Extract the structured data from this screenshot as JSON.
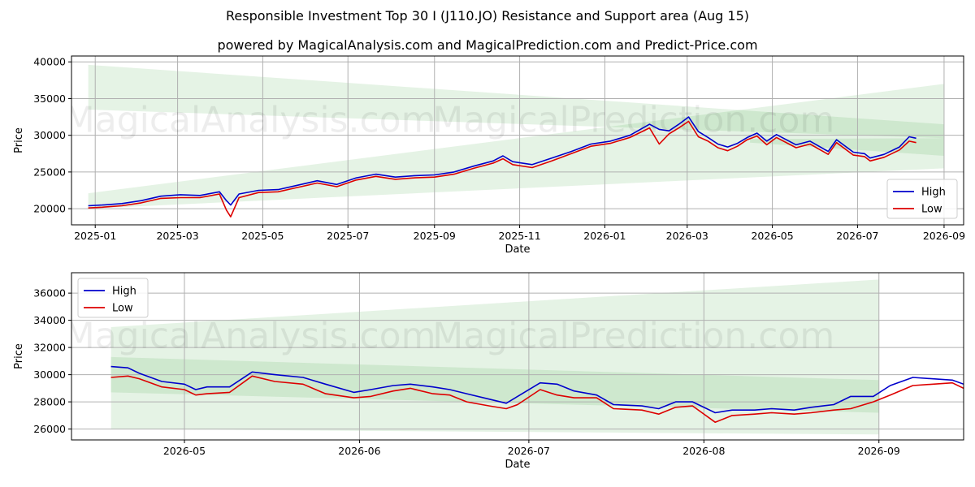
{
  "header": {
    "title": "Responsible Investment Top 30 I (J110.JO) Resistance and Support area (Aug 15)",
    "subtitle": "powered by MagicalAnalysis.com and MagicalPrediction.com and Predict-Price.com"
  },
  "watermark": {
    "text_left": "MagicalAnalysis.com",
    "text_right": "MagicalPrediction.com"
  },
  "colors": {
    "high": "#0000cc",
    "low": "#dd0000",
    "band": "#2ca02c",
    "grid": "#b0b0b0"
  },
  "chart_data": [
    {
      "type": "line",
      "xlabel": "Date",
      "ylabel": "Price",
      "x_ticks": [
        "2025-01",
        "2025-03",
        "2025-05",
        "2025-07",
        "2025-09",
        "2025-11",
        "2026-01",
        "2026-03",
        "2026-05",
        "2026-07",
        "2026-09"
      ],
      "x_range": [
        "2024-12-15",
        "2026-09-15"
      ],
      "y_ticks": [
        20000,
        25000,
        30000,
        35000,
        40000
      ],
      "ylim": [
        17800,
        40800
      ],
      "grid": true,
      "legend": "lower-right",
      "series": [
        {
          "name": "High",
          "color": "#0000cc",
          "points": [
            [
              "2024-12-27",
              20400
            ],
            [
              "2025-01-06",
              20500
            ],
            [
              "2025-01-20",
              20700
            ],
            [
              "2025-02-03",
              21100
            ],
            [
              "2025-02-17",
              21700
            ],
            [
              "2025-03-03",
              21900
            ],
            [
              "2025-03-17",
              21800
            ],
            [
              "2025-03-31",
              22300
            ],
            [
              "2025-04-05",
              21100
            ],
            [
              "2025-04-08",
              20500
            ],
            [
              "2025-04-14",
              22000
            ],
            [
              "2025-04-28",
              22500
            ],
            [
              "2025-05-12",
              22600
            ],
            [
              "2025-05-26",
              23200
            ],
            [
              "2025-06-09",
              23800
            ],
            [
              "2025-06-23",
              23300
            ],
            [
              "2025-07-07",
              24200
            ],
            [
              "2025-07-21",
              24700
            ],
            [
              "2025-08-04",
              24300
            ],
            [
              "2025-08-18",
              24500
            ],
            [
              "2025-09-01",
              24600
            ],
            [
              "2025-09-15",
              25000
            ],
            [
              "2025-09-29",
              25800
            ],
            [
              "2025-10-13",
              26500
            ],
            [
              "2025-10-20",
              27200
            ],
            [
              "2025-10-27",
              26400
            ],
            [
              "2025-11-10",
              26000
            ],
            [
              "2025-11-24",
              26900
            ],
            [
              "2025-12-08",
              27800
            ],
            [
              "2025-12-22",
              28800
            ],
            [
              "2026-01-05",
              29200
            ],
            [
              "2026-01-19",
              30000
            ],
            [
              "2026-02-02",
              31500
            ],
            [
              "2026-02-09",
              30800
            ],
            [
              "2026-02-16",
              30600
            ],
            [
              "2026-02-23",
              31500
            ],
            [
              "2026-03-02",
              32500
            ],
            [
              "2026-03-09",
              30500
            ],
            [
              "2026-03-16",
              29700
            ],
            [
              "2026-03-23",
              28800
            ],
            [
              "2026-03-30",
              28400
            ],
            [
              "2026-04-06",
              28900
            ],
            [
              "2026-04-13",
              29700
            ],
            [
              "2026-04-20",
              30300
            ],
            [
              "2026-04-27",
              29200
            ],
            [
              "2026-05-04",
              30100
            ],
            [
              "2026-05-18",
              28700
            ],
            [
              "2026-05-28",
              29200
            ],
            [
              "2026-06-10",
              27800
            ],
            [
              "2026-06-16",
              29400
            ],
            [
              "2026-06-28",
              27700
            ],
            [
              "2026-07-06",
              27500
            ],
            [
              "2026-07-10",
              26900
            ],
            [
              "2026-07-20",
              27400
            ],
            [
              "2026-07-31",
              28400
            ],
            [
              "2026-08-07",
              29800
            ],
            [
              "2026-08-12",
              29600
            ]
          ]
        },
        {
          "name": "Low",
          "color": "#dd0000",
          "points": [
            [
              "2024-12-27",
              20100
            ],
            [
              "2025-01-06",
              20200
            ],
            [
              "2025-01-20",
              20400
            ],
            [
              "2025-02-03",
              20800
            ],
            [
              "2025-02-17",
              21400
            ],
            [
              "2025-03-03",
              21500
            ],
            [
              "2025-03-17",
              21500
            ],
            [
              "2025-03-31",
              22000
            ],
            [
              "2025-04-05",
              19800
            ],
            [
              "2025-04-08",
              18900
            ],
            [
              "2025-04-14",
              21500
            ],
            [
              "2025-04-28",
              22200
            ],
            [
              "2025-05-12",
              22300
            ],
            [
              "2025-05-26",
              22900
            ],
            [
              "2025-06-09",
              23500
            ],
            [
              "2025-06-23",
              23000
            ],
            [
              "2025-07-07",
              23900
            ],
            [
              "2025-07-21",
              24400
            ],
            [
              "2025-08-04",
              24000
            ],
            [
              "2025-08-18",
              24200
            ],
            [
              "2025-09-01",
              24300
            ],
            [
              "2025-09-15",
              24700
            ],
            [
              "2025-09-29",
              25500
            ],
            [
              "2025-10-13",
              26200
            ],
            [
              "2025-10-20",
              26800
            ],
            [
              "2025-10-27",
              26000
            ],
            [
              "2025-11-10",
              25600
            ],
            [
              "2025-11-24",
              26500
            ],
            [
              "2025-12-08",
              27500
            ],
            [
              "2025-12-22",
              28500
            ],
            [
              "2026-01-05",
              28900
            ],
            [
              "2026-01-19",
              29700
            ],
            [
              "2026-02-02",
              31000
            ],
            [
              "2026-02-09",
              28800
            ],
            [
              "2026-02-16",
              30200
            ],
            [
              "2026-02-23",
              31000
            ],
            [
              "2026-03-02",
              31900
            ],
            [
              "2026-03-09",
              29800
            ],
            [
              "2026-03-16",
              29200
            ],
            [
              "2026-03-23",
              28300
            ],
            [
              "2026-03-30",
              27900
            ],
            [
              "2026-04-06",
              28500
            ],
            [
              "2026-04-13",
              29400
            ],
            [
              "2026-04-20",
              29900
            ],
            [
              "2026-04-27",
              28700
            ],
            [
              "2026-05-04",
              29700
            ],
            [
              "2026-05-18",
              28300
            ],
            [
              "2026-05-28",
              28800
            ],
            [
              "2026-06-10",
              27400
            ],
            [
              "2026-06-16",
              29000
            ],
            [
              "2026-06-28",
              27300
            ],
            [
              "2026-07-06",
              27100
            ],
            [
              "2026-07-10",
              26500
            ],
            [
              "2026-07-20",
              27000
            ],
            [
              "2026-07-31",
              28000
            ],
            [
              "2026-08-07",
              29200
            ],
            [
              "2026-08-12",
              29000
            ]
          ]
        }
      ],
      "bands": [
        {
          "x": [
            "2024-12-27",
            "2026-09-01"
          ],
          "upper": [
            39600,
            31500
          ],
          "lower": [
            33500,
            29600
          ]
        },
        {
          "x": [
            "2024-12-27",
            "2026-09-01"
          ],
          "upper": [
            22100,
            37000
          ],
          "lower": [
            20000,
            25500
          ]
        },
        {
          "x": [
            "2026-04-15",
            "2026-09-01"
          ],
          "upper": [
            29500,
            29600
          ],
          "lower": [
            29000,
            27200
          ]
        }
      ]
    },
    {
      "type": "line",
      "xlabel": "Date",
      "ylabel": "Price",
      "x_ticks": [
        "2026-05",
        "2026-06",
        "2026-07",
        "2026-08",
        "2026-09"
      ],
      "x_range": [
        "2026-04-11",
        "2026-09-16"
      ],
      "y_ticks": [
        26000,
        28000,
        30000,
        32000,
        34000,
        36000
      ],
      "ylim": [
        25200,
        37500
      ],
      "grid": true,
      "legend": "top-left",
      "series": [
        {
          "name": "High",
          "color": "#0000cc",
          "points": [
            [
              "2026-04-18",
              30600
            ],
            [
              "2026-04-21",
              30500
            ],
            [
              "2026-04-23",
              30100
            ],
            [
              "2026-04-27",
              29500
            ],
            [
              "2026-05-01",
              29300
            ],
            [
              "2026-05-03",
              28900
            ],
            [
              "2026-05-05",
              29100
            ],
            [
              "2026-05-09",
              29100
            ],
            [
              "2026-05-13",
              30200
            ],
            [
              "2026-05-17",
              30000
            ],
            [
              "2026-05-22",
              29800
            ],
            [
              "2026-05-26",
              29300
            ],
            [
              "2026-05-31",
              28700
            ],
            [
              "2026-06-03",
              28900
            ],
            [
              "2026-06-07",
              29200
            ],
            [
              "2026-06-10",
              29300
            ],
            [
              "2026-06-14",
              29100
            ],
            [
              "2026-06-17",
              28900
            ],
            [
              "2026-06-20",
              28600
            ],
            [
              "2026-06-24",
              28200
            ],
            [
              "2026-06-27",
              27900
            ],
            [
              "2026-06-29",
              28400
            ],
            [
              "2026-07-03",
              29400
            ],
            [
              "2026-07-06",
              29300
            ],
            [
              "2026-07-09",
              28800
            ],
            [
              "2026-07-13",
              28500
            ],
            [
              "2026-07-16",
              27800
            ],
            [
              "2026-07-21",
              27700
            ],
            [
              "2026-07-24",
              27500
            ],
            [
              "2026-07-27",
              28000
            ],
            [
              "2026-07-30",
              28000
            ],
            [
              "2026-08-03",
              27200
            ],
            [
              "2026-08-06",
              27400
            ],
            [
              "2026-08-10",
              27400
            ],
            [
              "2026-08-13",
              27500
            ],
            [
              "2026-08-17",
              27400
            ],
            [
              "2026-08-20",
              27600
            ],
            [
              "2026-08-24",
              27800
            ],
            [
              "2026-08-27",
              28400
            ],
            [
              "2026-08-31",
              28400
            ],
            [
              "2026-09-03",
              29200
            ],
            [
              "2026-09-07",
              29800
            ],
            [
              "2026-09-14",
              29600
            ],
            [
              "2026-09-16",
              29300
            ]
          ]
        },
        {
          "name": "Low",
          "color": "#dd0000",
          "points": [
            [
              "2026-04-18",
              29800
            ],
            [
              "2026-04-21",
              29900
            ],
            [
              "2026-04-23",
              29700
            ],
            [
              "2026-04-27",
              29100
            ],
            [
              "2026-05-01",
              28900
            ],
            [
              "2026-05-03",
              28500
            ],
            [
              "2026-05-05",
              28600
            ],
            [
              "2026-05-09",
              28700
            ],
            [
              "2026-05-13",
              29900
            ],
            [
              "2026-05-17",
              29500
            ],
            [
              "2026-05-22",
              29300
            ],
            [
              "2026-05-26",
              28600
            ],
            [
              "2026-05-31",
              28300
            ],
            [
              "2026-06-03",
              28400
            ],
            [
              "2026-06-07",
              28800
            ],
            [
              "2026-06-10",
              29000
            ],
            [
              "2026-06-14",
              28600
            ],
            [
              "2026-06-17",
              28500
            ],
            [
              "2026-06-20",
              28000
            ],
            [
              "2026-06-24",
              27700
            ],
            [
              "2026-06-27",
              27500
            ],
            [
              "2026-06-29",
              27800
            ],
            [
              "2026-07-03",
              28900
            ],
            [
              "2026-07-06",
              28500
            ],
            [
              "2026-07-09",
              28300
            ],
            [
              "2026-07-13",
              28300
            ],
            [
              "2026-07-16",
              27500
            ],
            [
              "2026-07-21",
              27400
            ],
            [
              "2026-07-24",
              27100
            ],
            [
              "2026-07-27",
              27600
            ],
            [
              "2026-07-30",
              27700
            ],
            [
              "2026-08-03",
              26500
            ],
            [
              "2026-08-06",
              27000
            ],
            [
              "2026-08-10",
              27100
            ],
            [
              "2026-08-13",
              27200
            ],
            [
              "2026-08-17",
              27100
            ],
            [
              "2026-08-20",
              27200
            ],
            [
              "2026-08-24",
              27400
            ],
            [
              "2026-08-27",
              27500
            ],
            [
              "2026-08-31",
              28000
            ],
            [
              "2026-09-03",
              28500
            ],
            [
              "2026-09-07",
              29200
            ],
            [
              "2026-09-14",
              29400
            ],
            [
              "2026-09-16",
              29000
            ]
          ]
        }
      ],
      "bands": [
        {
          "x": [
            "2026-04-18",
            "2026-09-01"
          ],
          "upper": [
            33500,
            37000
          ],
          "lower": [
            26000,
            25600
          ]
        },
        {
          "x": [
            "2026-04-18",
            "2026-09-01"
          ],
          "upper": [
            31300,
            29600
          ],
          "lower": [
            28700,
            27200
          ]
        }
      ]
    }
  ]
}
